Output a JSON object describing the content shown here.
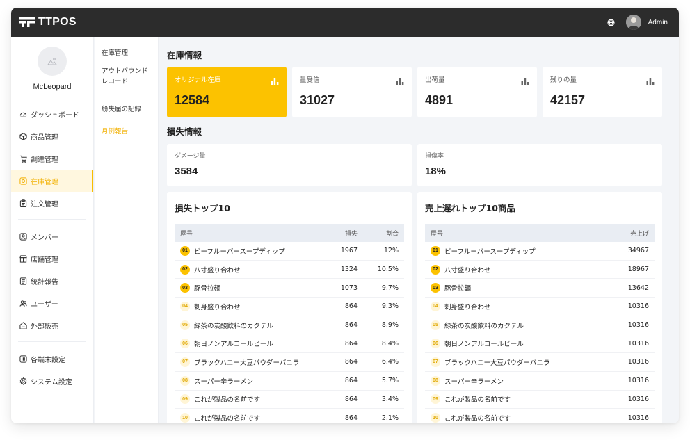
{
  "app": {
    "name": "TTPOS"
  },
  "header": {
    "user_name": "Admin"
  },
  "profile": {
    "name": "McLeopard"
  },
  "sidebar": {
    "groups": [
      [
        {
          "label": "ダッシュボード",
          "icon": "dashboard-icon"
        },
        {
          "label": "商品管理",
          "icon": "box-icon"
        },
        {
          "label": "調達管理",
          "icon": "cart-icon"
        },
        {
          "label": "在庫管理",
          "icon": "inventory-icon",
          "active": true
        },
        {
          "label": "注文管理",
          "icon": "clipboard-icon"
        }
      ],
      [
        {
          "label": "メンバー",
          "icon": "member-icon"
        },
        {
          "label": "店舗管理",
          "icon": "store-icon"
        },
        {
          "label": "統計報告",
          "icon": "report-icon"
        },
        {
          "label": "ユーザー",
          "icon": "users-icon"
        },
        {
          "label": "外部販売",
          "icon": "external-sales-icon"
        }
      ],
      [
        {
          "label": "各端末設定",
          "icon": "terminal-icon"
        },
        {
          "label": "システム設定",
          "icon": "gear-icon"
        }
      ]
    ]
  },
  "subnav": {
    "items": [
      {
        "label": "在庫管理"
      },
      {
        "label": "アウトバウンドレコード"
      },
      {
        "label": "紛失届の記録"
      },
      {
        "label": "月例報告",
        "active": true
      }
    ]
  },
  "inventory": {
    "title": "在庫情報",
    "cards": [
      {
        "label": "オリジナル在庫",
        "value": "12584",
        "highlight": true
      },
      {
        "label": "量受信",
        "value": "31027"
      },
      {
        "label": "出荷量",
        "value": "4891"
      },
      {
        "label": "残りの量",
        "value": "42157"
      }
    ]
  },
  "loss": {
    "title": "損失情報",
    "cards": [
      {
        "label": "ダメージ量",
        "value": "3584"
      },
      {
        "label": "損傷率",
        "value": "18%"
      }
    ]
  },
  "loss_top10": {
    "title": "損失トップ10",
    "headers": {
      "name": "屋号",
      "loss": "損失",
      "ratio": "割合"
    },
    "rows": [
      {
        "rank": "01",
        "name": "ビーフルーバースープディップ",
        "loss": "1967",
        "ratio": "12%"
      },
      {
        "rank": "02",
        "name": "八寸盛り合わせ",
        "loss": "1324",
        "ratio": "10.5%"
      },
      {
        "rank": "03",
        "name": "豚骨拉麺",
        "loss": "1073",
        "ratio": "9.7%"
      },
      {
        "rank": "04",
        "name": "刺身盛り合わせ",
        "loss": "864",
        "ratio": "9.3%"
      },
      {
        "rank": "05",
        "name": "緑茶の炭酸飲料のカクテル",
        "loss": "864",
        "ratio": "8.9%"
      },
      {
        "rank": "06",
        "name": "朝日ノンアルコールビール",
        "loss": "864",
        "ratio": "8.4%"
      },
      {
        "rank": "07",
        "name": "ブラックハニー大豆パウダーバニラ",
        "loss": "864",
        "ratio": "6.4%"
      },
      {
        "rank": "08",
        "name": "スーパー辛ラーメン",
        "loss": "864",
        "ratio": "5.7%"
      },
      {
        "rank": "09",
        "name": "これが製品の名前です",
        "loss": "864",
        "ratio": "3.4%"
      },
      {
        "rank": "10",
        "name": "これが製品の名前です",
        "loss": "864",
        "ratio": "2.1%"
      }
    ]
  },
  "slow_top10": {
    "title": "売上遅れトップ10商品",
    "headers": {
      "name": "屋号",
      "sales": "売上げ"
    },
    "rows": [
      {
        "rank": "01",
        "name": "ビーフルーバースープディップ",
        "sales": "34967"
      },
      {
        "rank": "02",
        "name": "八寸盛り合わせ",
        "sales": "18967"
      },
      {
        "rank": "03",
        "name": "豚骨拉麺",
        "sales": "13642"
      },
      {
        "rank": "04",
        "name": "刺身盛り合わせ",
        "sales": "10316"
      },
      {
        "rank": "05",
        "name": "緑茶の炭酸飲料のカクテル",
        "sales": "10316"
      },
      {
        "rank": "06",
        "name": "朝日ノンアルコールビール",
        "sales": "10316"
      },
      {
        "rank": "07",
        "name": "ブラックハニー大豆パウダーバニラ",
        "sales": "10316"
      },
      {
        "rank": "08",
        "name": "スーパー辛ラーメン",
        "sales": "10316"
      },
      {
        "rank": "09",
        "name": "これが製品の名前です",
        "sales": "10316"
      },
      {
        "rank": "10",
        "name": "これが製品の名前です",
        "sales": "10316"
      }
    ]
  },
  "colors": {
    "accent": "#fcc200",
    "topbar": "#2c2c2c",
    "background": "#f3f5f8"
  }
}
